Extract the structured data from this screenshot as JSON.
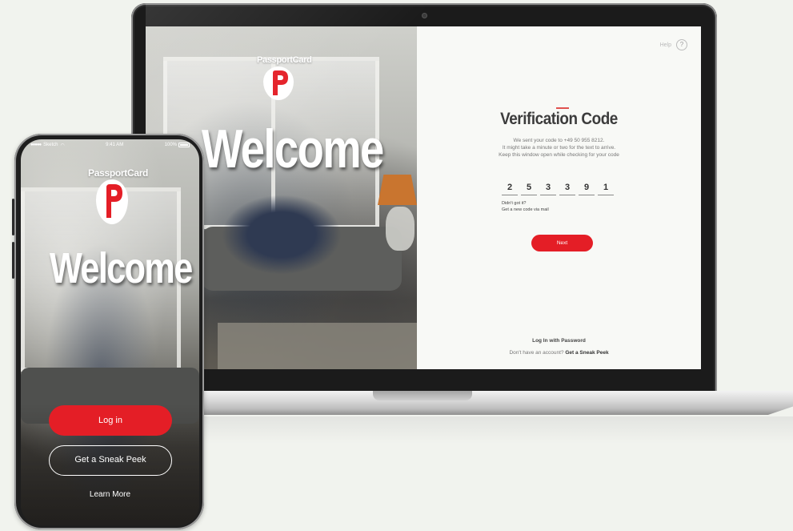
{
  "brand": {
    "name": "PassportCard",
    "accent": "#e41e26"
  },
  "laptop": {
    "welcome": "Welcome",
    "help": {
      "label": "Help",
      "icon": "?"
    },
    "form": {
      "title": "Verification Code",
      "description": [
        "We sent your code to +49 50 955 8212.",
        "It might take a minute or two for the text to arrive.",
        "Keep this window open while checking for your code"
      ],
      "code_digits": [
        "2",
        "5",
        "3",
        "3",
        "9",
        "1"
      ],
      "resend": [
        "Didn't got it?",
        "Get a new code via mail"
      ],
      "next_label": "Next",
      "login_password": "Log In with Password",
      "no_account": "Don't have an account?",
      "sneak_peek": "Get a Sneak Peek"
    }
  },
  "phone": {
    "status": {
      "carrier": "Sketch",
      "time": "9:41 AM",
      "battery": "100%"
    },
    "welcome": "Welcome",
    "login_label": "Log in",
    "sneak_label": "Get a Sneak Peek",
    "learn_more": "Learn More"
  }
}
